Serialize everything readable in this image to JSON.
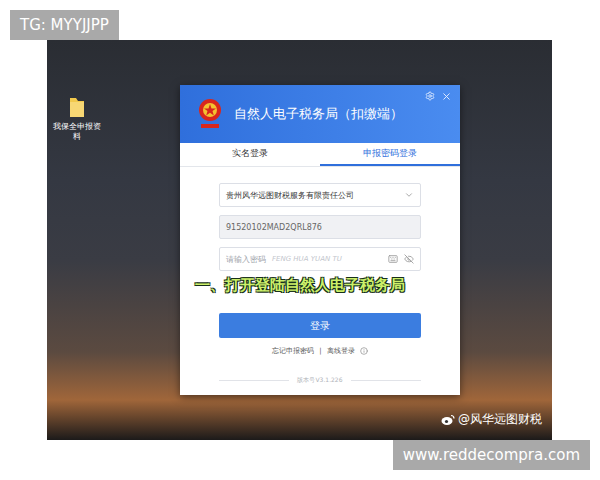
{
  "tags": {
    "top": "TG: MYYJJPP",
    "bottom": "www.reddecompra.com"
  },
  "desktop": {
    "icons": [
      {
        "label": "我保全申报资料"
      }
    ]
  },
  "dialog": {
    "title": "自然人电子税务局（扣缴端）",
    "tabs": [
      {
        "label": "实名登录",
        "selected": false
      },
      {
        "label": "申报密码登录",
        "selected": true
      }
    ],
    "company_select": {
      "value": "贵州风华远图财税服务有限责任公司"
    },
    "tax_id_field": {
      "value": "91520102MAD2QRL876",
      "disabled": true
    },
    "password_field": {
      "placeholder": "请输入密码",
      "watermark": "FENG HUA YUAN TU"
    },
    "login_button": "登录",
    "links": [
      "忘记申报密码",
      "离线登录"
    ],
    "separator": "|",
    "version": "版本号V3.1.226"
  },
  "caption": "一、打开登陆自然人电子税务局",
  "watermark": "@风华远图财税"
}
